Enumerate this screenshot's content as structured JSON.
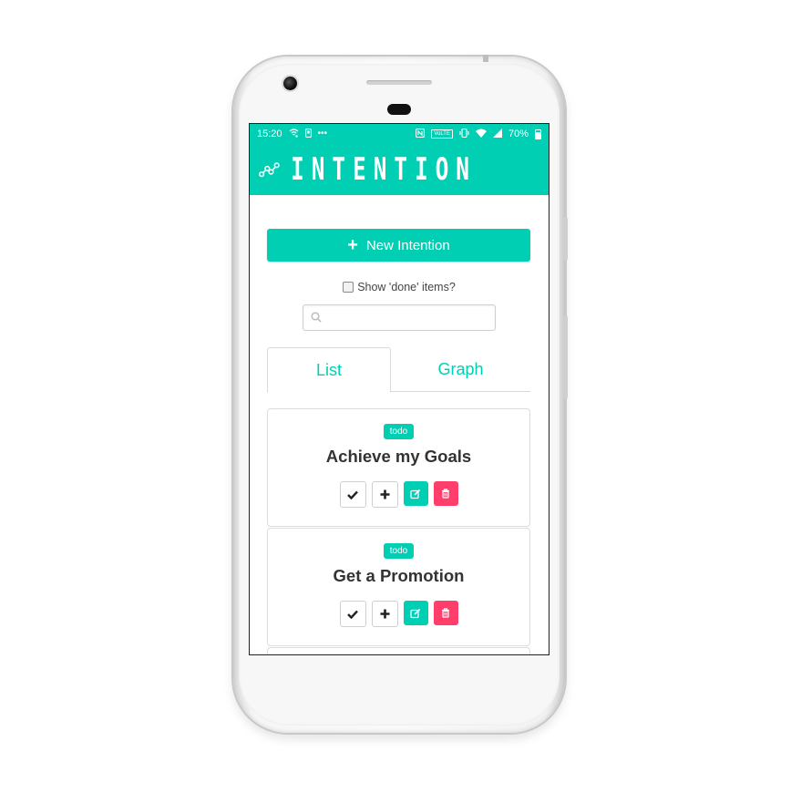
{
  "status_bar": {
    "time": "15:20",
    "battery": "70%",
    "volte": "VoLTE"
  },
  "header": {
    "title": "INTENTION",
    "logo_icon": "connected-nodes-icon"
  },
  "new_button": {
    "label": "New Intention",
    "icon": "plus-icon"
  },
  "show_done": {
    "label": "Show 'done' items?",
    "checked": false
  },
  "search": {
    "value": "",
    "placeholder": "",
    "icon": "search-icon"
  },
  "tabs": [
    {
      "label": "List",
      "active": true
    },
    {
      "label": "Graph",
      "active": false
    }
  ],
  "intentions": [
    {
      "status": "todo",
      "title": "Achieve my Goals"
    },
    {
      "status": "todo",
      "title": "Get a Promotion"
    }
  ],
  "colors": {
    "accent": "#00cfb4",
    "danger": "#ff3e6c",
    "text": "#333333"
  }
}
